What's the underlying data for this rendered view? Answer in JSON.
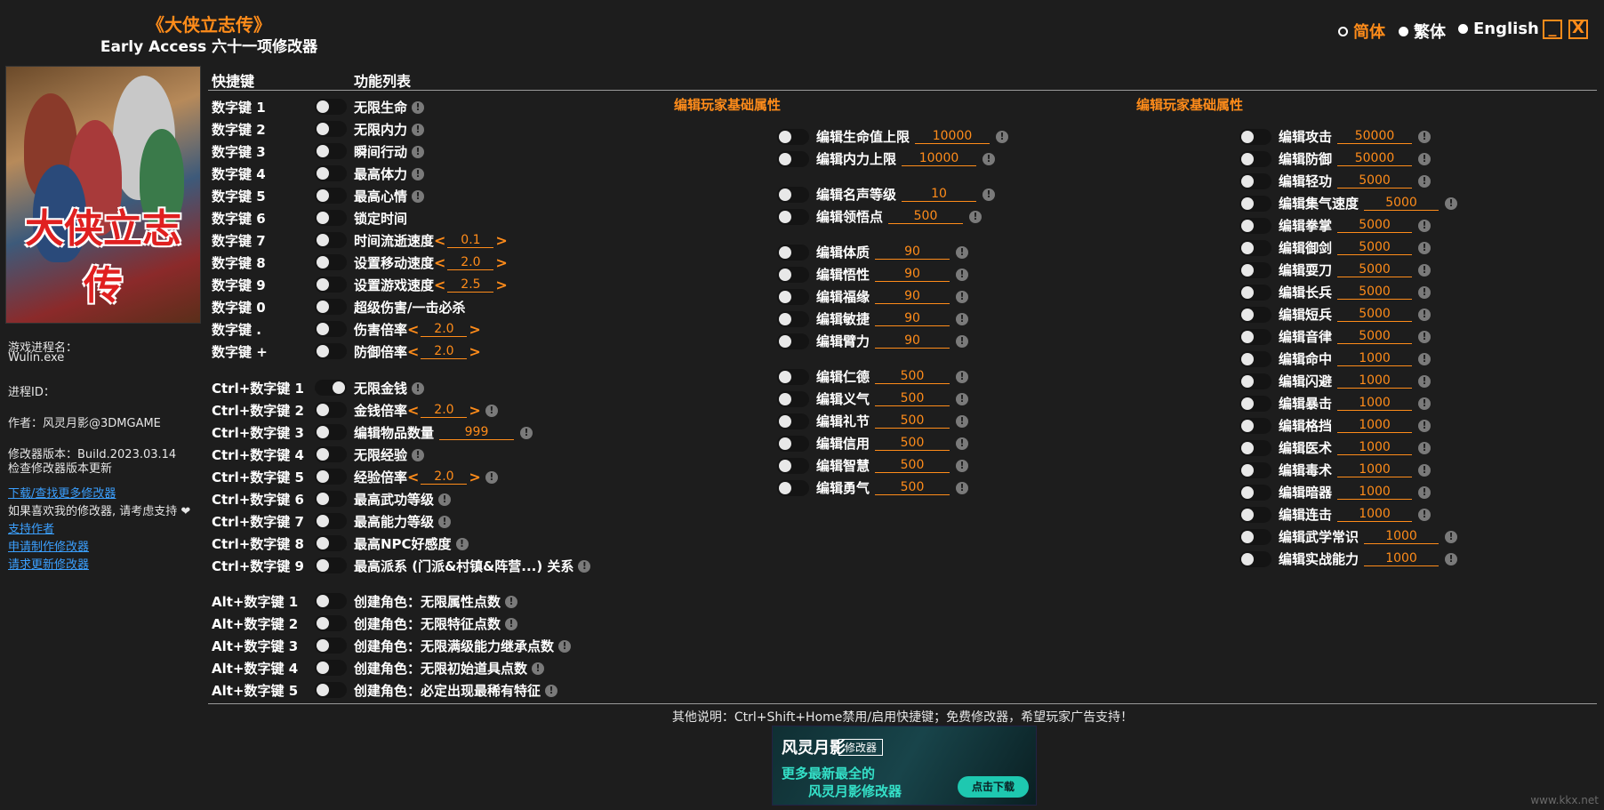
{
  "header": {
    "title": "《大侠立志传》",
    "subtitle": "Early Access 六十一项修改器"
  },
  "languages": [
    {
      "label": "简体",
      "selected": true
    },
    {
      "label": "繁体",
      "selected": false
    },
    {
      "label": "English",
      "selected": false
    }
  ],
  "window": {
    "minimize": "_",
    "close": "X"
  },
  "cover": {
    "title": "大侠立志传"
  },
  "sidebar": {
    "process_label": "游戏进程名：",
    "process_value": "Wulin.exe",
    "pid_label": "进程ID：",
    "author": "作者：风灵月影@3DMGAME",
    "version": "修改器版本：Build.2023.03.14",
    "check_update": "检查修改器版本更新",
    "link_download": "下载/查找更多修改器",
    "support_text": "如果喜欢我的修改器, 请考虑支持 ❤",
    "link_support": "支持作者",
    "link_request": "申请制作修改器",
    "link_update": "请求更新修改器"
  },
  "columns": {
    "hotkey": "快捷键",
    "features": "功能列表"
  },
  "hotkeys": [
    {
      "key": "数字键 1",
      "label": "无限生命",
      "on": false,
      "info": true
    },
    {
      "key": "数字键 2",
      "label": "无限内力",
      "on": false,
      "info": true
    },
    {
      "key": "数字键 3",
      "label": "瞬间行动",
      "on": false,
      "info": true
    },
    {
      "key": "数字键 4",
      "label": "最高体力",
      "on": false,
      "info": true
    },
    {
      "key": "数字键 5",
      "label": "最高心情",
      "on": false,
      "info": true
    },
    {
      "key": "数字键 6",
      "label": "锁定时间",
      "on": false,
      "info": false
    },
    {
      "key": "数字键 7",
      "label": "时间流逝速度",
      "on": false,
      "value": "0.1",
      "info": false
    },
    {
      "key": "数字键 8",
      "label": "设置移动速度",
      "on": false,
      "value": "2.0",
      "info": false
    },
    {
      "key": "数字键 9",
      "label": "设置游戏速度",
      "on": false,
      "value": "2.5",
      "info": false
    },
    {
      "key": "数字键 0",
      "label": "超级伤害/一击必杀",
      "on": false,
      "info": false
    },
    {
      "key": "数字键 .",
      "label": "伤害倍率",
      "on": false,
      "value": "2.0",
      "info": false
    },
    {
      "key": "数字键 +",
      "label": "防御倍率",
      "on": false,
      "value": "2.0",
      "info": false
    },
    {
      "key": "Ctrl+数字键 1",
      "label": "无限金钱",
      "on": true,
      "info": true
    },
    {
      "key": "Ctrl+数字键 2",
      "label": "金钱倍率",
      "on": false,
      "value": "2.0",
      "info": true
    },
    {
      "key": "Ctrl+数字键 3",
      "label": "编辑物品数量",
      "on": false,
      "edit": "999",
      "info": true
    },
    {
      "key": "Ctrl+数字键 4",
      "label": "无限经验",
      "on": false,
      "info": true
    },
    {
      "key": "Ctrl+数字键 5",
      "label": "经验倍率",
      "on": false,
      "value": "2.0",
      "info": true
    },
    {
      "key": "Ctrl+数字键 6",
      "label": "最高武功等级",
      "on": false,
      "info": true
    },
    {
      "key": "Ctrl+数字键 7",
      "label": "最高能力等级",
      "on": false,
      "info": true
    },
    {
      "key": "Ctrl+数字键 8",
      "label": "最高NPC好感度",
      "on": false,
      "info": true
    },
    {
      "key": "Ctrl+数字键 9",
      "label": "最高派系 (门派&村镇&阵营...) 关系",
      "on": false,
      "info": true
    },
    {
      "key": "Alt+数字键 1",
      "label": "创建角色：无限属性点数",
      "on": false,
      "info": true
    },
    {
      "key": "Alt+数字键 2",
      "label": "创建角色：无限特征点数",
      "on": false,
      "info": true
    },
    {
      "key": "Alt+数字键 3",
      "label": "创建角色：无限满级能力继承点数",
      "on": false,
      "info": true
    },
    {
      "key": "Alt+数字键 4",
      "label": "创建角色：无限初始道具点数",
      "on": false,
      "info": true
    },
    {
      "key": "Alt+数字键 5",
      "label": "创建角色：必定出现最稀有特征",
      "on": false,
      "info": true
    }
  ],
  "section2": {
    "title": "编辑玩家基础属性",
    "items": [
      {
        "label": "编辑生命值上限",
        "value": "10000"
      },
      {
        "label": "编辑内力上限",
        "value": "10000"
      },
      {
        "label": "编辑名声等级",
        "value": "10"
      },
      {
        "label": "编辑领悟点",
        "value": "500"
      },
      {
        "label": "编辑体质",
        "value": "90"
      },
      {
        "label": "编辑悟性",
        "value": "90"
      },
      {
        "label": "编辑福缘",
        "value": "90"
      },
      {
        "label": "编辑敏捷",
        "value": "90"
      },
      {
        "label": "编辑臂力",
        "value": "90"
      },
      {
        "label": "编辑仁德",
        "value": "500"
      },
      {
        "label": "编辑义气",
        "value": "500"
      },
      {
        "label": "编辑礼节",
        "value": "500"
      },
      {
        "label": "编辑信用",
        "value": "500"
      },
      {
        "label": "编辑智慧",
        "value": "500"
      },
      {
        "label": "编辑勇气",
        "value": "500"
      }
    ]
  },
  "section3": {
    "title": "编辑玩家基础属性",
    "items": [
      {
        "label": "编辑攻击",
        "value": "50000"
      },
      {
        "label": "编辑防御",
        "value": "50000"
      },
      {
        "label": "编辑轻功",
        "value": "5000"
      },
      {
        "label": "编辑集气速度",
        "value": "5000"
      },
      {
        "label": "编辑拳掌",
        "value": "5000"
      },
      {
        "label": "编辑御剑",
        "value": "5000"
      },
      {
        "label": "编辑耍刀",
        "value": "5000"
      },
      {
        "label": "编辑长兵",
        "value": "5000"
      },
      {
        "label": "编辑短兵",
        "value": "5000"
      },
      {
        "label": "编辑音律",
        "value": "5000"
      },
      {
        "label": "编辑命中",
        "value": "1000"
      },
      {
        "label": "编辑闪避",
        "value": "1000"
      },
      {
        "label": "编辑暴击",
        "value": "1000"
      },
      {
        "label": "编辑格挡",
        "value": "1000"
      },
      {
        "label": "编辑医术",
        "value": "1000"
      },
      {
        "label": "编辑毒术",
        "value": "1000"
      },
      {
        "label": "编辑暗器",
        "value": "1000"
      },
      {
        "label": "编辑连击",
        "value": "1000"
      },
      {
        "label": "编辑武学常识",
        "value": "1000"
      },
      {
        "label": "编辑实战能力",
        "value": "1000"
      }
    ]
  },
  "footer": {
    "note": "其他说明：Ctrl+Shift+Home禁用/启用快捷键；免费修改器，希望玩家广告支持！"
  },
  "ad": {
    "logo": "风灵月影",
    "tag": "修改器",
    "line1": "更多最新最全的",
    "line2": "风灵月影修改器",
    "cta": "点击下载"
  },
  "watermark": "www.kkx.net"
}
